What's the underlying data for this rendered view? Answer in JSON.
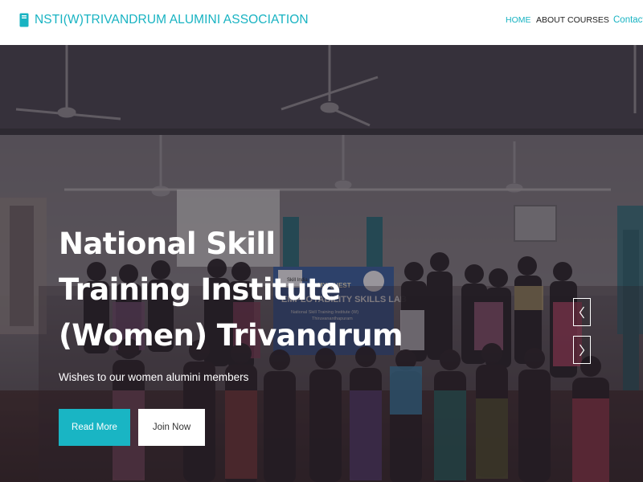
{
  "header": {
    "brand": "NSTI(W)TRIVANDRUM ALUMINI ASSOCIATION",
    "brand_icon": "book-icon",
    "brand_color": "#18b3c2",
    "nav": [
      {
        "label": "HOME",
        "active": true
      },
      {
        "label": "ABOUT",
        "active": false
      },
      {
        "label": "COURSES",
        "active": false
      }
    ],
    "contact_label": "Contact"
  },
  "hero": {
    "title": "National Skill Training Institute (Women) Trivandrum",
    "subtitle": "Wishes to our women alumini members",
    "buttons": {
      "primary_label": "Read More",
      "secondary_label": "Join Now"
    },
    "banner": {
      "line1": "MY QUEST",
      "line2": "EMPLOYABILITY SKILLS LAB",
      "line3": "National Skill Training Institute (W)",
      "line4": "Thiruvananthapuram",
      "logo_text": "Skill India"
    },
    "accent_color": "#19b5c4",
    "prev_icon": "chevron-left-icon",
    "next_icon": "chevron-right-icon"
  }
}
